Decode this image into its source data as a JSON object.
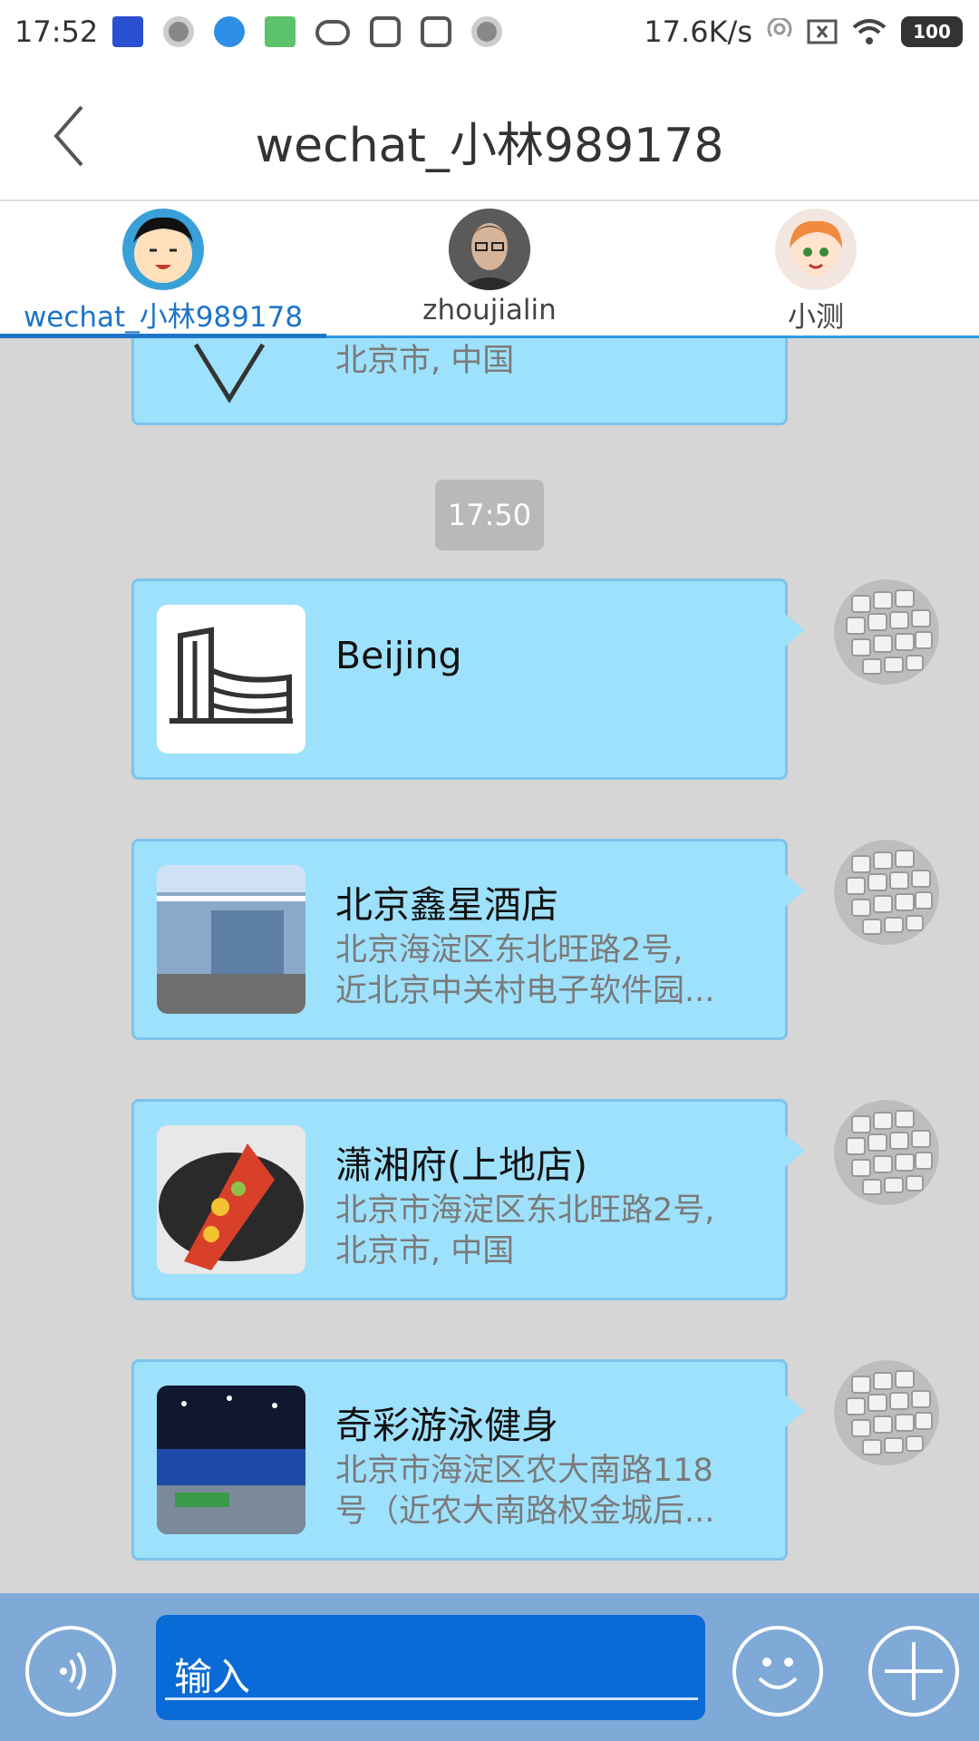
{
  "status_bar": {
    "time": "17:52",
    "network_speed": "17.6K/s",
    "battery": "100",
    "icons": [
      "app-notification-icon",
      "record-icon",
      "bird-icon",
      "maps-icon",
      "cloud-icon",
      "s-app-icon",
      "s-app-icon",
      "record-icon"
    ]
  },
  "header": {
    "title": "wechat_小林989178"
  },
  "tabs": [
    {
      "label": "wechat_小林989178",
      "active": true
    },
    {
      "label": "zhoujialin",
      "active": false
    },
    {
      "label": "小测",
      "active": false
    }
  ],
  "messages": [
    {
      "title": "",
      "subtitle": "北京市, 中国",
      "partial": true
    },
    {
      "type": "timestamp",
      "text": "17:50"
    },
    {
      "title": "Beijing",
      "subtitle": "",
      "thumb": "building-icon"
    },
    {
      "title": "北京鑫星酒店",
      "subtitle": "北京海淀区东北旺路2号,\n近北京中关村电子软件园...",
      "thumb": "hotel-photo"
    },
    {
      "title": "潇湘府(上地店)",
      "subtitle": "北京市海淀区东北旺路2号,\n北京市, 中国",
      "thumb": "food-photo"
    },
    {
      "title": "奇彩游泳健身",
      "subtitle": "北京市海淀区农大南路118\n号（近农大南路权金城后...",
      "thumb": "gym-photo"
    }
  ],
  "input_bar": {
    "placeholder": "输入"
  },
  "colors": {
    "bubble": "#9ee1fc",
    "accent": "#1d74c9",
    "input_bg": "#0a6bd6",
    "bottom_bar": "#7fa9d6"
  }
}
